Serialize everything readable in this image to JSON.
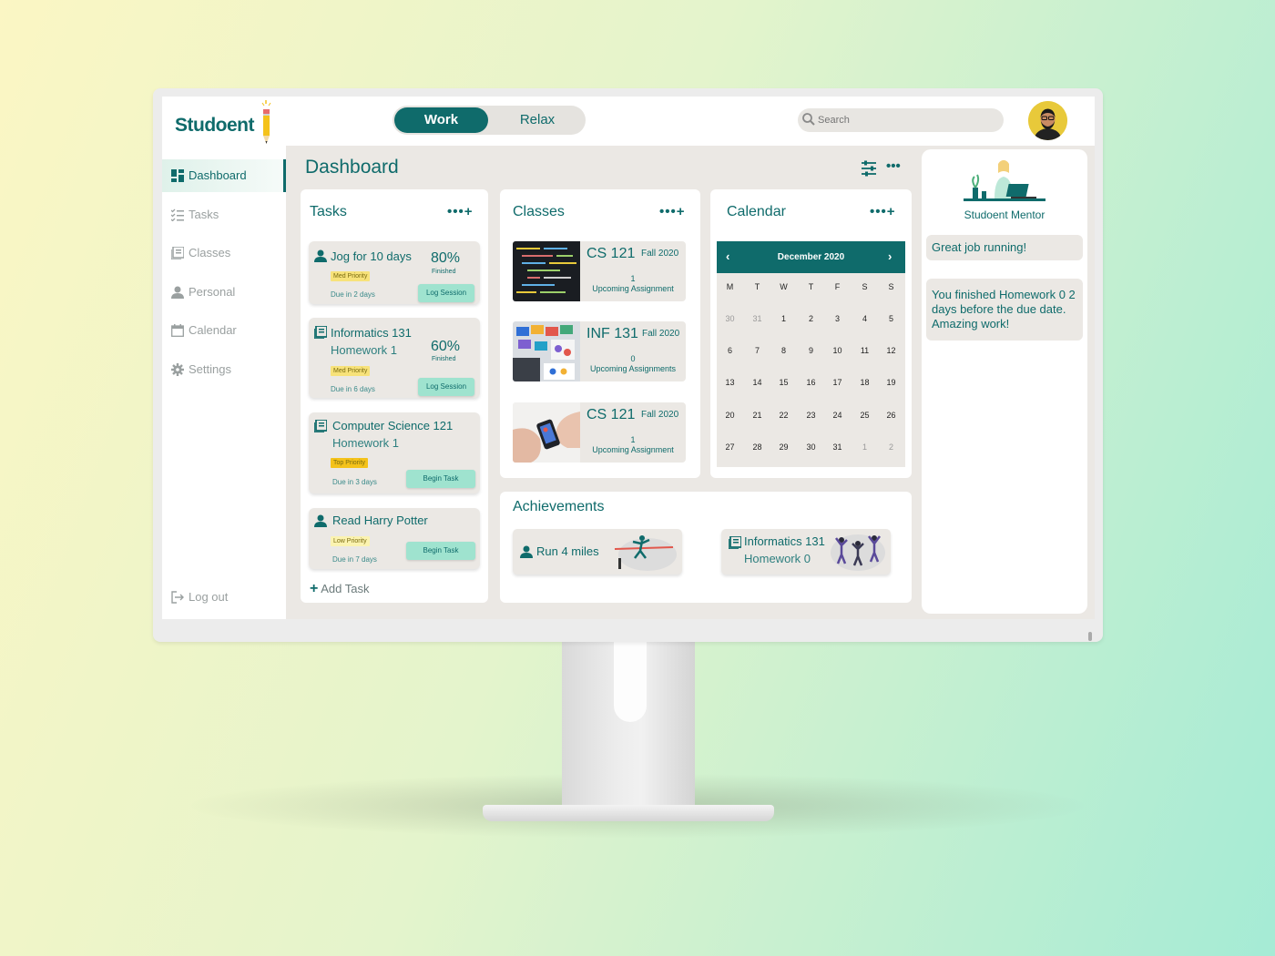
{
  "app": {
    "name": "Studoent"
  },
  "mode_toggle": {
    "work": "Work",
    "relax": "Relax"
  },
  "search": {
    "placeholder": "Search"
  },
  "sidebar": {
    "items": [
      {
        "label": "Dashboard",
        "icon": "dashboard-icon",
        "active": true
      },
      {
        "label": "Tasks",
        "icon": "tasks-icon"
      },
      {
        "label": "Classes",
        "icon": "classes-icon"
      },
      {
        "label": "Personal",
        "icon": "person-icon"
      },
      {
        "label": "Calendar",
        "icon": "calendar-icon"
      },
      {
        "label": "Settings",
        "icon": "gear-icon"
      }
    ],
    "logout": "Log out"
  },
  "dashboard": {
    "title": "Dashboard",
    "more": "•••"
  },
  "tasks": {
    "title": "Tasks",
    "items": [
      {
        "title": "Jog for 10 days",
        "subtitle": "",
        "percent": "80%",
        "finished": "Finished",
        "priority": "Med Priority",
        "due": "Due in 2 days",
        "button": "Log Session",
        "icon": "person-icon"
      },
      {
        "title": "Informatics 131",
        "subtitle": "Homework 1",
        "percent": "60%",
        "finished": "Finished",
        "priority": "Med Priority",
        "due": "Due in 6 days",
        "button": "Log Session",
        "icon": "book-icon"
      },
      {
        "title": "Computer Science 121",
        "subtitle": "Homework 1",
        "percent": "",
        "finished": "",
        "priority": "Top Priority",
        "due": "Due in 3 days",
        "button": "Begin Task",
        "icon": "book-icon"
      },
      {
        "title": "Read Harry Potter",
        "subtitle": "",
        "percent": "",
        "finished": "",
        "priority": "Low Priority",
        "due": "Due in 7 days",
        "button": "Begin Task",
        "icon": "person-icon"
      }
    ],
    "add_task": "Add Task"
  },
  "classes": {
    "title": "Classes",
    "items": [
      {
        "code": "CS 121",
        "term": "Fall 2020",
        "count": "1",
        "label": "Upcoming Assignment"
      },
      {
        "code": "INF 131",
        "term": "Fall 2020",
        "count": "0",
        "label": "Upcoming Assignments"
      },
      {
        "code": "CS 121",
        "term": "Fall 2020",
        "count": "1",
        "label": "Upcoming Assignment"
      }
    ]
  },
  "calendar": {
    "title": "Calendar",
    "month": "December 2020",
    "weekdays": [
      "M",
      "T",
      "W",
      "T",
      "F",
      "S",
      "S"
    ],
    "weeks": [
      [
        "30",
        "31",
        "1",
        "2",
        "3",
        "4",
        "5"
      ],
      [
        "6",
        "7",
        "8",
        "9",
        "10",
        "11",
        "12"
      ],
      [
        "13",
        "14",
        "15",
        "16",
        "17",
        "18",
        "19"
      ],
      [
        "20",
        "21",
        "22",
        "23",
        "24",
        "25",
        "26"
      ],
      [
        "27",
        "28",
        "29",
        "30",
        "31",
        "1",
        "2"
      ]
    ]
  },
  "achievements": {
    "title": "Achievements",
    "items": [
      {
        "title": "Run 4 miles",
        "subtitle": "",
        "icon": "person-icon"
      },
      {
        "title": "Informatics 131",
        "subtitle": "Homework 0",
        "icon": "book-icon"
      }
    ]
  },
  "mentor": {
    "name": "Studoent Mentor",
    "messages": [
      "Great job running!",
      "You finished Homework 0 2 days before the due date. Amazing work!"
    ]
  },
  "colors": {
    "primary": "#0f6b6b",
    "mint": "#9fe3cf",
    "panel": "#ebe8e4",
    "med_priority": "#f7e27a",
    "top_priority": "#f4c21a",
    "low_priority": "#fbf3b0"
  }
}
